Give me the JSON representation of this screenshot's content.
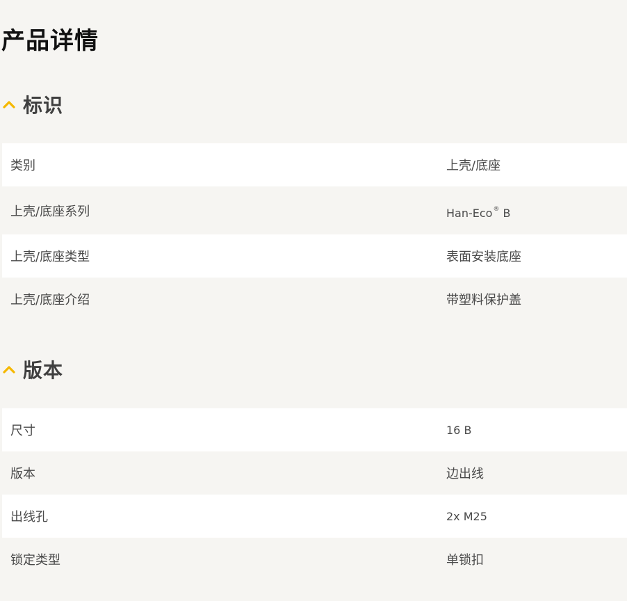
{
  "page": {
    "title": "产品详情"
  },
  "colors": {
    "accent": "#f5b800",
    "background": "#f6f5f2",
    "row_white": "#ffffff",
    "title_text": "#111111",
    "body_text": "#4a4a4a"
  },
  "sections": [
    {
      "title": "标识",
      "icon": "chevron-up-icon",
      "rows": [
        {
          "label": "类别",
          "value": "上壳/底座"
        },
        {
          "label": "上壳/底座系列",
          "value": "Han-Eco",
          "value_suffix": "®",
          "value_tail": " B"
        },
        {
          "label": "上壳/底座类型",
          "value": "表面安装底座"
        },
        {
          "label": "上壳/底座介绍",
          "value": "带塑料保护盖"
        }
      ]
    },
    {
      "title": "版本",
      "icon": "chevron-up-icon",
      "rows": [
        {
          "label": "尺寸",
          "value": "16 B"
        },
        {
          "label": "版本",
          "value": "边出线"
        },
        {
          "label": "出线孔",
          "value": "2x M25"
        },
        {
          "label": "锁定类型",
          "value": "单锁扣"
        }
      ]
    }
  ]
}
